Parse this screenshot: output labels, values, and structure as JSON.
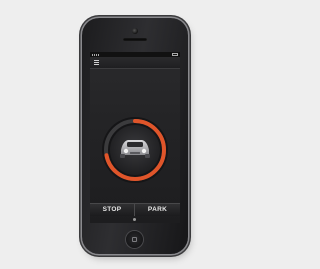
{
  "screen": {
    "title": "",
    "status_time": ""
  },
  "dial": {
    "label": "",
    "sublabel": "",
    "progress": 0.72,
    "ring_color": "#e0552a",
    "ring_track_color": "#3b3b3d"
  },
  "buttons": {
    "stop_label": "STOP",
    "park_label": "PARK"
  },
  "brand": {
    "text": ""
  },
  "icons": {
    "menu": "menu-icon",
    "car": "car-icon",
    "home": "home-button-icon"
  }
}
